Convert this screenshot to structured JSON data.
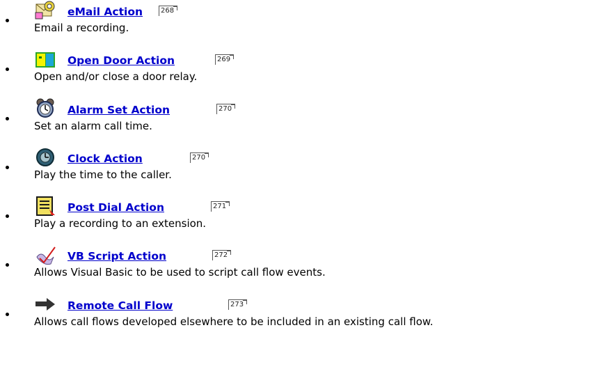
{
  "actions": [
    {
      "title": "eMail Action",
      "page": "268",
      "description": "Email a recording.",
      "icon": "email-envelope-icon"
    },
    {
      "title": "Open Door Action",
      "page": "269",
      "description": "Open and/or close a door relay.",
      "icon": "open-door-icon"
    },
    {
      "title": "Alarm Set Action",
      "page": "270",
      "description": "Set an alarm call time.",
      "icon": "alarm-clock-icon"
    },
    {
      "title": "Clock Action",
      "page": "270",
      "description": "Play the time to the caller.",
      "icon": "clock-icon"
    },
    {
      "title": "Post Dial Action",
      "page": "271",
      "description": "Play a recording to an extension.",
      "icon": "post-dial-notepad-icon"
    },
    {
      "title": "VB Script Action",
      "page": "272",
      "description": "Allows Visual Basic to be used to script call flow events.",
      "icon": "vb-script-icon"
    },
    {
      "title": "Remote Call Flow",
      "page": "273",
      "description": "Allows call flows developed elsewhere to be included in an existing call flow.",
      "icon": "remote-call-flow-arrow-icon"
    }
  ]
}
